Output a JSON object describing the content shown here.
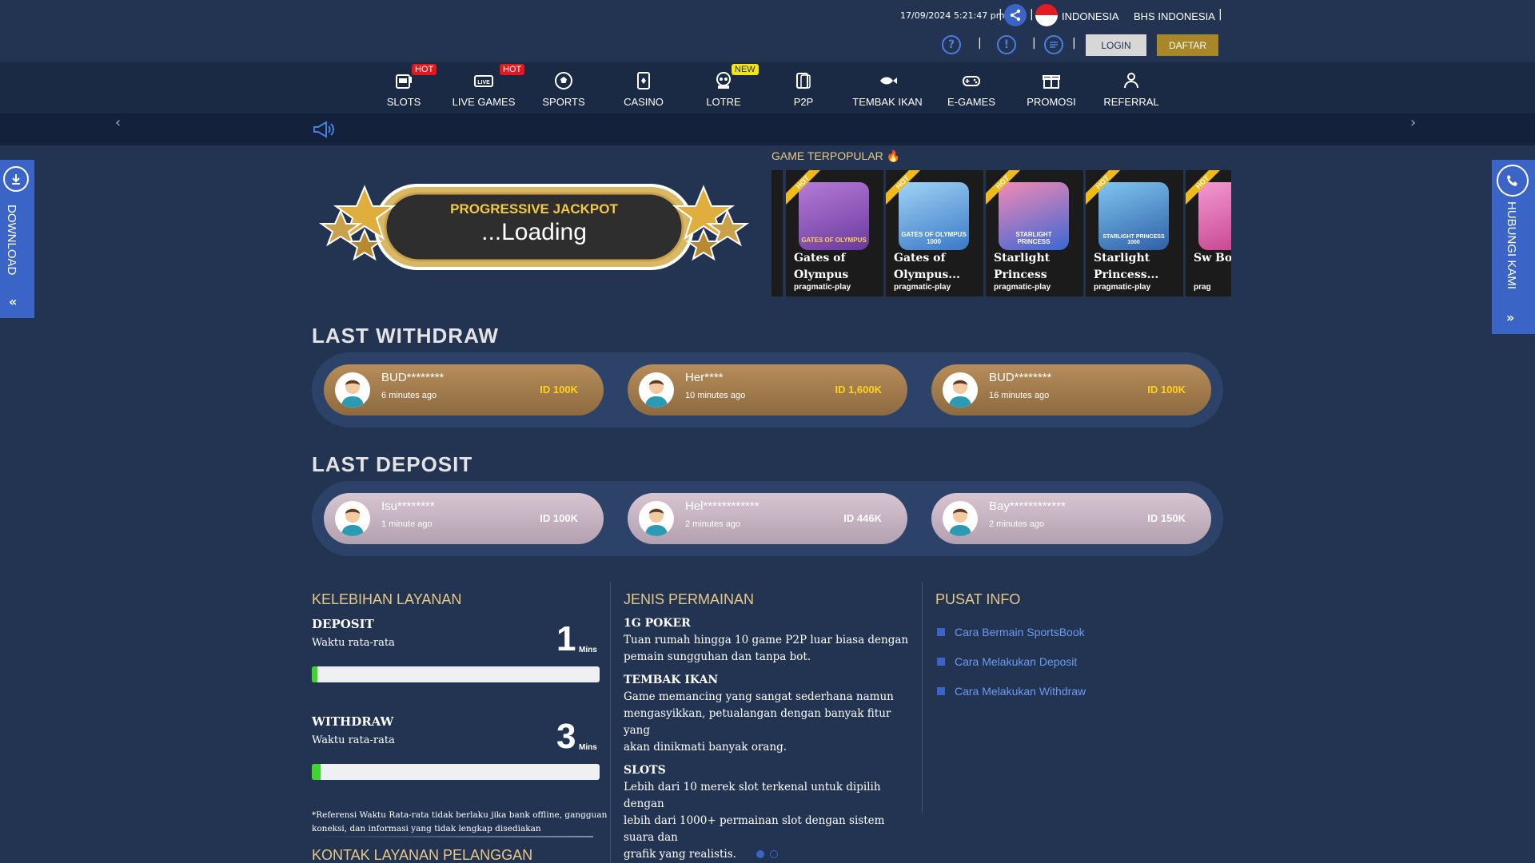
{
  "header": {
    "datetime": "17/09/2024 5:21:47 pm",
    "country": "INDONESIA",
    "language": "BHS INDONESIA",
    "login_label": "LOGIN",
    "register_label": "DAFTAR"
  },
  "nav": {
    "items": [
      {
        "label": "SLOTS",
        "icon": "slot-machine-icon",
        "badge": "HOT"
      },
      {
        "label": "LIVE GAMES",
        "icon": "live-icon",
        "badge": "HOT"
      },
      {
        "label": "SPORTS",
        "icon": "soccer-ball-icon",
        "badge": ""
      },
      {
        "label": "CASINO",
        "icon": "cards-icon",
        "badge": ""
      },
      {
        "label": "LOTRE",
        "icon": "lottery-icon",
        "badge": "NEW"
      },
      {
        "label": "P2P",
        "icon": "p2p-cards-icon",
        "badge": ""
      },
      {
        "label": "TEMBAK IKAN",
        "icon": "fish-icon",
        "badge": ""
      },
      {
        "label": "E-GAMES",
        "icon": "gamepad-icon",
        "badge": ""
      },
      {
        "label": "PROMOSI",
        "icon": "gift-icon",
        "badge": ""
      },
      {
        "label": "REFERRAL",
        "icon": "referral-icon",
        "badge": ""
      }
    ]
  },
  "sidebar": {
    "download_label": "DOWNLOAD",
    "contact_label": "HUBUNGI KAMI"
  },
  "jackpot": {
    "title": "PROGRESSIVE JACKPOT",
    "value": "...Loading"
  },
  "popular": {
    "title": "GAME TERPOPULAR",
    "games": [
      {
        "name": "Gates of Olympus",
        "provider": "pragmatic-play",
        "ribbon": "HOT",
        "thumb_label": "GATES OF OLYMPUS"
      },
      {
        "name": "Gates of Olympus...",
        "provider": "pragmatic-play",
        "ribbon": "HOT",
        "thumb_label": "GATES OF OLYMPUS 1000"
      },
      {
        "name": "Starlight Princess",
        "provider": "pragmatic-play",
        "ribbon": "HOT",
        "thumb_label": "STARLIGHT PRINCESS"
      },
      {
        "name": "Starlight Princess...",
        "provider": "pragmatic-play",
        "ribbon": "HOT",
        "thumb_label": "STARLIGHT PRINCESS 1000"
      },
      {
        "name": "Sw Bo",
        "provider": "prag",
        "ribbon": "HOT",
        "thumb_label": ""
      }
    ]
  },
  "withdraw": {
    "title": "LAST WITHDRAW",
    "items": [
      {
        "user": "BUD********",
        "time": "6 minutes ago",
        "amount": "ID 100K"
      },
      {
        "user": "Her****",
        "time": "10 minutes ago",
        "amount": "ID 1,600K"
      },
      {
        "user": "BUD********",
        "time": "16 minutes ago",
        "amount": "ID 100K"
      }
    ]
  },
  "deposit": {
    "title": "LAST DEPOSIT",
    "items": [
      {
        "user": "Isu********",
        "time": "1 minute ago",
        "amount": "ID 100K"
      },
      {
        "user": "Hel************",
        "time": "2 minutes ago",
        "amount": "ID 446K"
      },
      {
        "user": "Bay************",
        "time": "2 minutes ago",
        "amount": "ID 150K"
      }
    ]
  },
  "service": {
    "title": "KELEBIHAN LAYANAN",
    "deposit": {
      "label": "DEPOSIT",
      "sub": "Waktu rata-rata",
      "value": "1",
      "unit": "Mins",
      "progress": 0.02
    },
    "withdraw": {
      "label": "WITHDRAW",
      "sub": "Waktu rata-rata",
      "value": "3",
      "unit": "Mins",
      "progress": 0.03
    },
    "note_line1": "*Referensi Waktu Rata-rata tidak berlaku jika bank offline, gangguan",
    "note_line2": "koneksi, dan informasi yang tidak lengkap disediakan",
    "contact_title": "KONTAK LAYANAN PELANGGAN"
  },
  "games_info": {
    "title": "JENIS PERMAINAN",
    "items": [
      {
        "name": "1G POKER",
        "lines": [
          "Tuan rumah hingga 10 game P2P luar biasa dengan",
          "pemain sungguhan dan tanpa bot."
        ]
      },
      {
        "name": "TEMBAK IKAN",
        "lines": [
          "Game memancing yang sangat sederhana namun",
          "mengasyikkan, petualangan dengan banyak fitur yang",
          "akan dinikmati banyak orang."
        ]
      },
      {
        "name": "SLOTS",
        "lines": [
          "Lebih dari 10 merek slot terkenal untuk dipilih dengan",
          "lebih dari 1000+ permainan slot dengan sistem suara dan",
          "grafik yang realistis."
        ]
      }
    ]
  },
  "info_center": {
    "title": "PUSAT INFO",
    "links": [
      "Cara Bermain SportsBook",
      "Cara Melakukan Deposit",
      "Cara Melakukan Withdraw"
    ]
  },
  "colors": {
    "background": "#223452",
    "accent_blue": "#3b64c7",
    "gold": "#a88728",
    "hot_badge": "#e4161e",
    "new_badge": "#f6e312"
  }
}
